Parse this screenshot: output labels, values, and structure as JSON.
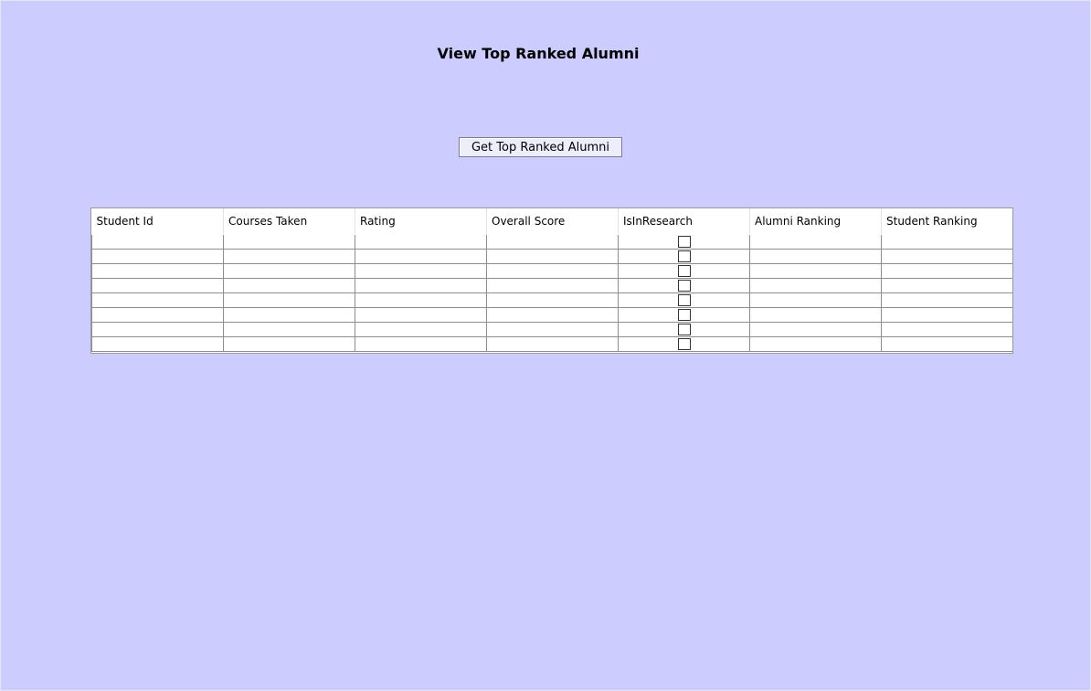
{
  "page": {
    "title": "View Top Ranked Alumni"
  },
  "actions": {
    "get_button_label": "Get Top Ranked Alumni"
  },
  "table": {
    "columns": [
      "Student Id",
      "Courses Taken",
      "Rating",
      "Overall Score",
      "IsInResearch",
      "Alumni Ranking",
      "Student Ranking"
    ],
    "rows": [
      [
        "",
        "",
        "",
        "",
        false,
        "",
        ""
      ],
      [
        "",
        "",
        "",
        "",
        false,
        "",
        ""
      ],
      [
        "",
        "",
        "",
        "",
        false,
        "",
        ""
      ],
      [
        "",
        "",
        "",
        "",
        false,
        "",
        ""
      ],
      [
        "",
        "",
        "",
        "",
        false,
        "",
        ""
      ],
      [
        "",
        "",
        "",
        "",
        false,
        "",
        ""
      ],
      [
        "",
        "",
        "",
        "",
        false,
        "",
        ""
      ],
      [
        "",
        "",
        "",
        "",
        false,
        "",
        ""
      ]
    ]
  },
  "colors": {
    "background": "#ccccff",
    "button_face": "#ededfb",
    "grid_line": "#8e8e8e"
  }
}
